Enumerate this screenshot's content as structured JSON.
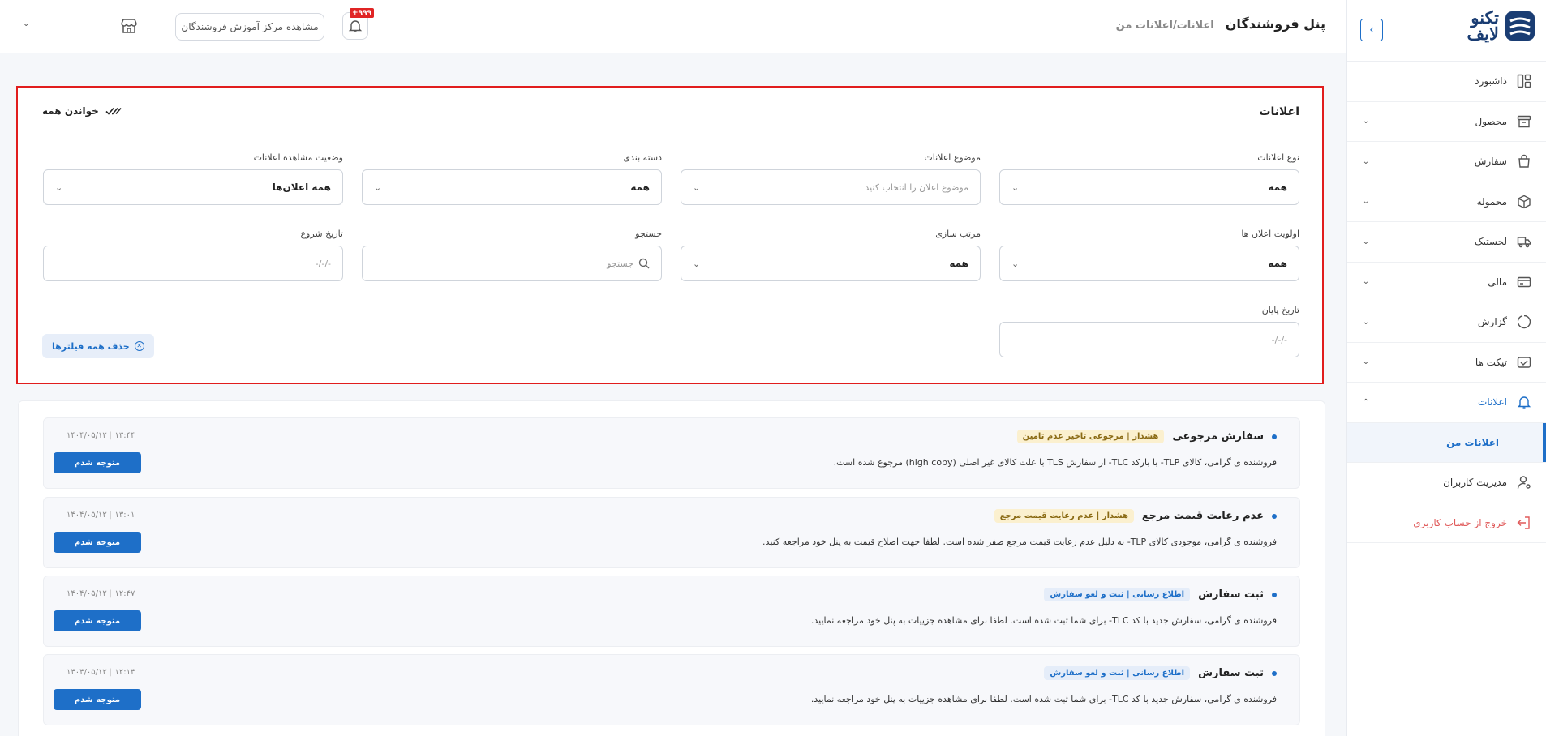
{
  "brand": {
    "logo_text": "تکنو\nلایف"
  },
  "sidebar": {
    "items": [
      {
        "label": "داشبورد",
        "icon": "dashboard-icon",
        "chevron": false
      },
      {
        "label": "محصول",
        "icon": "box-icon",
        "chevron": true
      },
      {
        "label": "سفارش",
        "icon": "bag-icon",
        "chevron": true
      },
      {
        "label": "محموله",
        "icon": "package-icon",
        "chevron": true
      },
      {
        "label": "لجستیک",
        "icon": "truck-icon",
        "chevron": true
      },
      {
        "label": "مالی",
        "icon": "card-icon",
        "chevron": true
      },
      {
        "label": "گزارش",
        "icon": "chart-icon",
        "chevron": true
      },
      {
        "label": "تیکت ها",
        "icon": "ticket-icon",
        "chevron": true
      },
      {
        "label": "اعلانات",
        "icon": "bell-icon",
        "chevron": true
      }
    ],
    "sub_active": "اعلانات من",
    "users": "مدیریت کاربران",
    "logout": "خروج از حساب کاربری"
  },
  "header": {
    "title": "پنل فروشندگان",
    "breadcrumb": "اعلانات/اعلانات من",
    "notif_badge": "+۹۹۹",
    "training": "مشاهده مرکز آموزش فروشندگان"
  },
  "filters": {
    "title": "اعلانات",
    "read_all": "خواندن همه",
    "fields": [
      {
        "label": "نوع اعلانات",
        "value": "همه",
        "placeholder": ""
      },
      {
        "label": "موضوع اعلانات",
        "value": "",
        "placeholder": "موضوع اعلان را انتخاب کنید"
      },
      {
        "label": "دسته بندی",
        "value": "همه",
        "placeholder": ""
      },
      {
        "label": "وضعیت مشاهده اعلانات",
        "value": "همه اعلان‌ها",
        "placeholder": ""
      },
      {
        "label": "اولویت اعلان ها",
        "value": "همه",
        "placeholder": ""
      },
      {
        "label": "مرتب سازی",
        "value": "همه",
        "placeholder": ""
      },
      {
        "label": "جستجو",
        "value": "",
        "placeholder": "جستجو"
      },
      {
        "label": "تاریخ شروع",
        "value": "",
        "placeholder": "-/-/-"
      },
      {
        "label": "تاریخ پایان",
        "value": "",
        "placeholder": "-/-/-"
      }
    ],
    "clear_all": "حذف همه فیلترها"
  },
  "notifications": [
    {
      "title": "سفارش مرجوعی",
      "tag": "هشدار | مرجوعی تاخیر عدم تامین",
      "tag_type": "warn",
      "body": "فروشنده ی گرامی، کالای TLP- با بارکد TLC- از سفارش TLS با علت کالای غیر اصلی (high copy) مرجوع شده است.",
      "date": "۱۴۰۴/۰۵/۱۲",
      "time": "۱۳:۴۴",
      "action": "متوجه شدم"
    },
    {
      "title": "عدم رعایت قیمت مرجع",
      "tag": "هشدار | عدم رعایت قیمت مرجع",
      "tag_type": "warn",
      "body": "فروشنده ی گرامی، موجودی کالای TLP- به دلیل عدم رعایت قیمت مرجع صفر شده است. لطفا جهت اصلاح قیمت به پنل خود مراجعه کنید.",
      "date": "۱۴۰۴/۰۵/۱۲",
      "time": "۱۳:۰۱",
      "action": "متوجه شدم"
    },
    {
      "title": "ثبت سفارش",
      "tag": "اطلاع رسانی | ثبت و لغو سفارش",
      "tag_type": "info",
      "body": "فروشنده ی گرامی، سفارش جدید با کد TLC- برای شما ثبت شده است. لطفا برای مشاهده جزییات به پنل خود مراجعه نمایید.",
      "date": "۱۴۰۴/۰۵/۱۲",
      "time": "۱۲:۴۷",
      "action": "متوجه شدم"
    },
    {
      "title": "ثبت سفارش",
      "tag": "اطلاع رسانی | ثبت و لغو سفارش",
      "tag_type": "info",
      "body": "فروشنده ی گرامی، سفارش جدید با کد TLC- برای شما ثبت شده است. لطفا برای مشاهده جزییات به پنل خود مراجعه نمایید.",
      "date": "۱۴۰۴/۰۵/۱۲",
      "time": "۱۲:۱۴",
      "action": "متوجه شدم"
    }
  ]
}
